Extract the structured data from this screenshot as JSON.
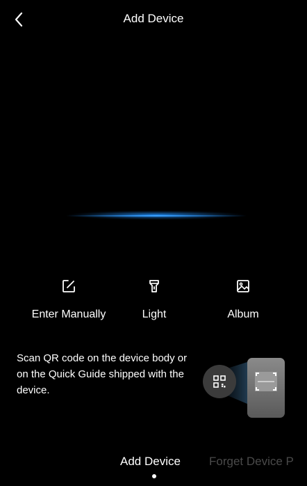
{
  "header": {
    "title": "Add Device",
    "back_icon": "chevron-left-icon"
  },
  "actions": [
    {
      "label": "Enter Manually",
      "icon": "edit-icon"
    },
    {
      "label": "Light",
      "icon": "flashlight-icon"
    },
    {
      "label": "Album",
      "icon": "image-icon"
    }
  ],
  "instruction": {
    "text": "Scan QR code on the device body or on the Quick Guide shipped with the device."
  },
  "tabs": [
    {
      "label": "Add Device",
      "active": true
    },
    {
      "label": "Forget Device P",
      "active": false
    }
  ],
  "colors": {
    "background": "#000000",
    "scan_line": "#1e90ff",
    "inactive_tab": "#4a4a4a"
  }
}
